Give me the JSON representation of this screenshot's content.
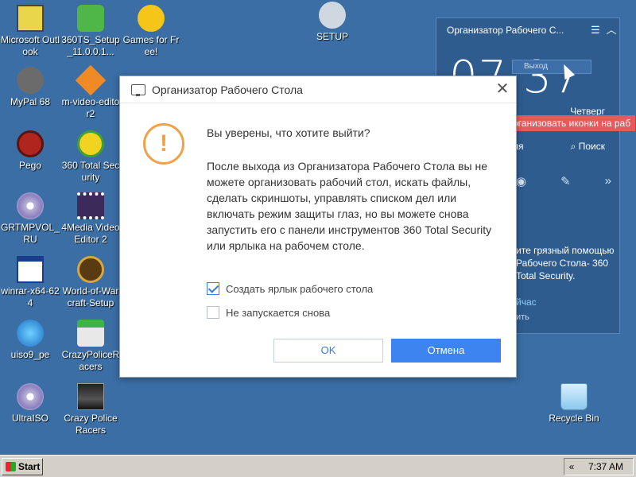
{
  "desktop": {
    "icons": [
      {
        "label": "Microsoft Outlook",
        "icon": "outlook-icon"
      },
      {
        "label": "360TS_Setup_11.0.0.1...",
        "icon": "installer-icon"
      },
      {
        "label": "Games for Free!",
        "icon": "games-icon"
      },
      {
        "label": "SETUP",
        "icon": "setup-icon"
      },
      {
        "label": "MyPal 68",
        "icon": "mypal-icon"
      },
      {
        "label": "m-video-editor2",
        "icon": "video-editor-icon"
      },
      {
        "label": "Pego",
        "icon": "pego-icon"
      },
      {
        "label": "360 Total Security",
        "icon": "security-icon"
      },
      {
        "label": "GRTMPVOL_RU",
        "icon": "disc-icon"
      },
      {
        "label": "4Media Video Editor 2",
        "icon": "film-icon"
      },
      {
        "label": "winrar-x64-624",
        "icon": "window-icon"
      },
      {
        "label": "World-of-Warcraft-Setup",
        "icon": "wow-icon"
      },
      {
        "label": "uiso9_pe",
        "icon": "globe-disc-icon"
      },
      {
        "label": "CrazyPoliceRacers",
        "icon": "download-icon"
      },
      {
        "label": "UltraISO",
        "icon": "disc-icon"
      },
      {
        "label": "Crazy Police Racers",
        "icon": "car-icon"
      },
      {
        "label": "Recycle Bin",
        "icon": "recycle-bin-icon"
      }
    ]
  },
  "widget": {
    "title": "Организатор Рабочего С...",
    "clock": "07:37",
    "exit_fragment": "Выход",
    "day": "Четверг",
    "banner": "рганизовать иконки на раб",
    "left_fragment": "ля",
    "search_label": "Поиск",
    "text": "ите грязный помощью Рабочего Стола- 360 Total Security.",
    "link": "йчас",
    "small": "ить"
  },
  "dialog": {
    "title": "Организатор Рабочего Стола",
    "question": "Вы уверены, что хотите выйти?",
    "body": "После выхода из Организатора Рабочего Стола вы не можете организовать рабочий стол, искать файлы, сделать скриншоты, управлять списком дел или включать режим защиты глаз, но вы можете снова запустить его с панели инструментов 360 Total Security или ярлыка на рабочем столе.",
    "checkbox_shortcut": {
      "label": "Создать ярлык рабочего стола",
      "checked": true
    },
    "checkbox_no_restart": {
      "label": "Не запускается снова",
      "checked": false
    },
    "ok_label": "OK",
    "cancel_label": "Отмена"
  },
  "taskbar": {
    "start_label": "Start",
    "time": "7:37 AM",
    "chevron": "«"
  },
  "colors": {
    "desktop_bg": "#3a6ea5",
    "accent_blue": "#3d84f0",
    "warning_orange": "#f0a24a",
    "banner_red": "#e85a5a"
  }
}
